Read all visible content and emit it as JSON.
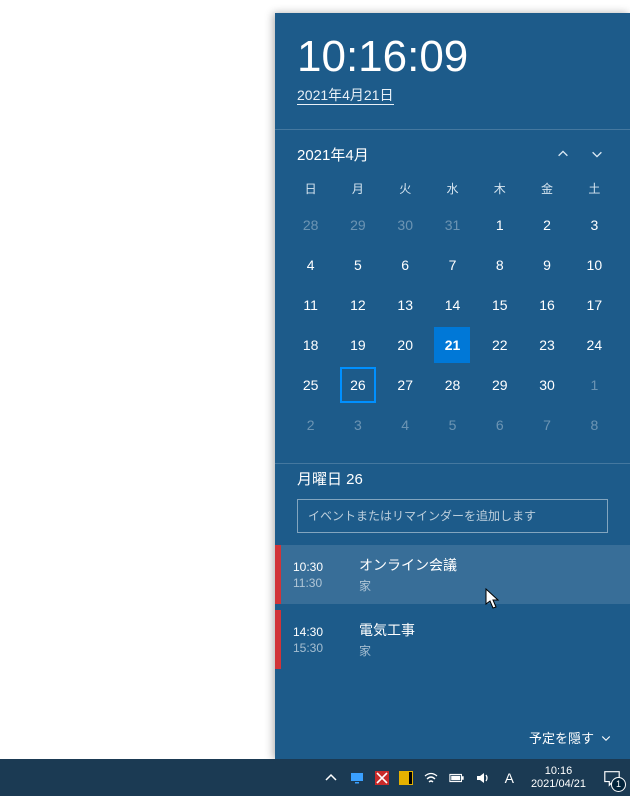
{
  "clock": {
    "time": "10:16:09",
    "date": "2021年4月21日"
  },
  "calendar": {
    "month_label": "2021年4月",
    "day_headers": [
      "日",
      "月",
      "火",
      "水",
      "木",
      "金",
      "土"
    ],
    "weeks": [
      [
        {
          "d": "28",
          "dim": true
        },
        {
          "d": "29",
          "dim": true
        },
        {
          "d": "30",
          "dim": true
        },
        {
          "d": "31",
          "dim": true
        },
        {
          "d": "1"
        },
        {
          "d": "2"
        },
        {
          "d": "3"
        }
      ],
      [
        {
          "d": "4"
        },
        {
          "d": "5"
        },
        {
          "d": "6"
        },
        {
          "d": "7"
        },
        {
          "d": "8"
        },
        {
          "d": "9"
        },
        {
          "d": "10"
        }
      ],
      [
        {
          "d": "11"
        },
        {
          "d": "12"
        },
        {
          "d": "13"
        },
        {
          "d": "14"
        },
        {
          "d": "15"
        },
        {
          "d": "16"
        },
        {
          "d": "17"
        }
      ],
      [
        {
          "d": "18"
        },
        {
          "d": "19"
        },
        {
          "d": "20"
        },
        {
          "d": "21",
          "today": true
        },
        {
          "d": "22"
        },
        {
          "d": "23"
        },
        {
          "d": "24"
        }
      ],
      [
        {
          "d": "25"
        },
        {
          "d": "26",
          "selected": true
        },
        {
          "d": "27"
        },
        {
          "d": "28"
        },
        {
          "d": "29"
        },
        {
          "d": "30"
        },
        {
          "d": "1",
          "dim": true
        }
      ],
      [
        {
          "d": "2",
          "dim": true
        },
        {
          "d": "3",
          "dim": true
        },
        {
          "d": "4",
          "dim": true
        },
        {
          "d": "5",
          "dim": true
        },
        {
          "d": "6",
          "dim": true
        },
        {
          "d": "7",
          "dim": true
        },
        {
          "d": "8",
          "dim": true
        }
      ]
    ]
  },
  "agenda": {
    "header": "月曜日 26",
    "add_placeholder": "イベントまたはリマインダーを追加します",
    "events": [
      {
        "start": "10:30",
        "end": "11:30",
        "title": "オンライン会議",
        "location": "家",
        "highlight": true
      },
      {
        "start": "14:30",
        "end": "15:30",
        "title": "電気工事",
        "location": "家",
        "highlight": false
      }
    ],
    "hide_label": "予定を隠す"
  },
  "taskbar": {
    "ime": "A",
    "clock_time": "10:16",
    "clock_date": "2021/04/21",
    "notification_count": "1"
  }
}
